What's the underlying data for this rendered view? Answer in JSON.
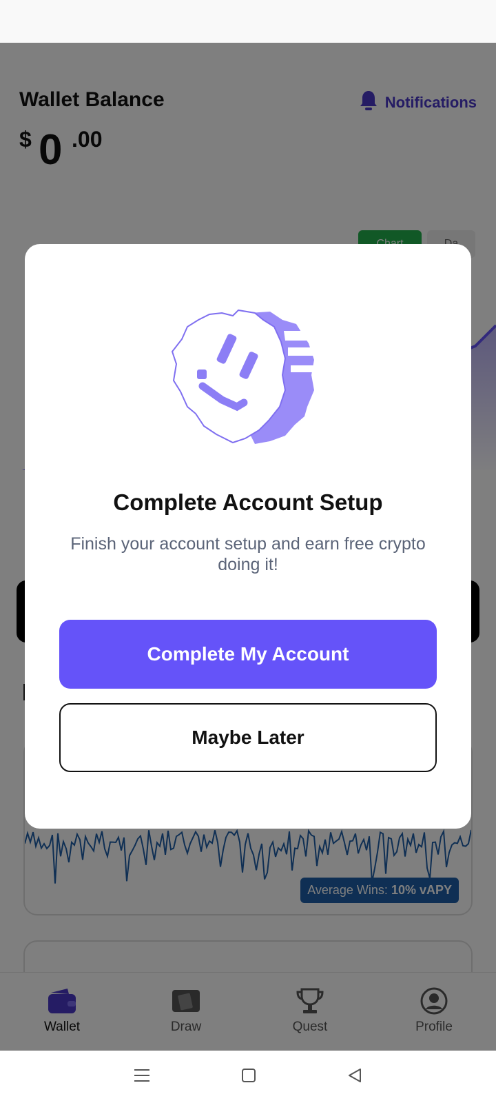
{
  "header": {
    "title": "Wallet Balance",
    "balance_currency": "$",
    "balance_whole": "0",
    "balance_cents": ".00",
    "notifications_label": "Notifications"
  },
  "chart_toggle": {
    "active_label": "Chart",
    "inactive_label": "Da"
  },
  "wins": {
    "badge_prefix": "Average Wins:",
    "badge_value": "10% vAPY"
  },
  "modal": {
    "title": "Complete Account Setup",
    "description": "Finish your account setup and earn free crypto doing it!",
    "primary_label": "Complete My Account",
    "secondary_label": "Maybe Later"
  },
  "bottom_nav": {
    "items": [
      {
        "label": "Wallet",
        "icon": "wallet-icon",
        "active": true
      },
      {
        "label": "Draw",
        "icon": "draw-icon",
        "active": false
      },
      {
        "label": "Quest",
        "icon": "trophy-icon",
        "active": false
      },
      {
        "label": "Profile",
        "icon": "profile-icon",
        "active": false
      }
    ]
  },
  "colors": {
    "accent": "#6553f9",
    "notification": "#4a39c9",
    "badge": "#1f5fa8",
    "toggle_active": "#22b14c"
  }
}
